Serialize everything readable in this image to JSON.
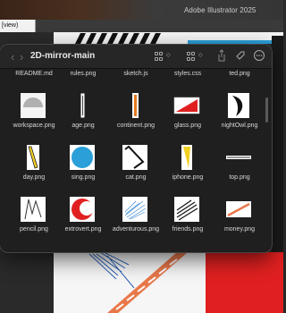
{
  "app": {
    "title": "Adobe Illustrator 2025",
    "tab_label": "[view)"
  },
  "window": {
    "title": "2D-mirror-main",
    "back_glyph": "‹",
    "forward_glyph": "›",
    "more_glyph": "⋯"
  },
  "files": [
    {
      "name": "README.md"
    },
    {
      "name": "rules.png"
    },
    {
      "name": "sketch.js"
    },
    {
      "name": "styles.css"
    },
    {
      "name": "ted.png"
    },
    {
      "name": "workspace.png",
      "icon": "semicircle-gray"
    },
    {
      "name": "age.png",
      "icon": "vertical-bar-outline"
    },
    {
      "name": "continent.png",
      "icon": "vertical-bar-orange"
    },
    {
      "name": "glass.png",
      "icon": "red-triangle-card"
    },
    {
      "name": "nightOwl.png",
      "icon": "black-crescent-shape"
    },
    {
      "name": "day.png",
      "icon": "yellow-pencil"
    },
    {
      "name": "sing.png",
      "icon": "blue-circle"
    },
    {
      "name": "cat.png",
      "icon": "black-angle-line"
    },
    {
      "name": "iphone.png",
      "icon": "yellow-triangle"
    },
    {
      "name": "top.png",
      "icon": "horizontal-line"
    },
    {
      "name": "pencil.png",
      "icon": "zigzag-sketch"
    },
    {
      "name": "extrovert.png",
      "icon": "red-crescent"
    },
    {
      "name": "adventurous.png",
      "icon": "blue-scribble"
    },
    {
      "name": "friends.png",
      "icon": "diagonal-black-lines"
    },
    {
      "name": "money.png",
      "icon": "orange-diagonal-bar"
    }
  ],
  "colors": {
    "finder_bg": "#1f1f1f",
    "accent_red": "#e02020",
    "accent_blue": "#2a9fd8",
    "accent_yellow": "#f0d020"
  }
}
